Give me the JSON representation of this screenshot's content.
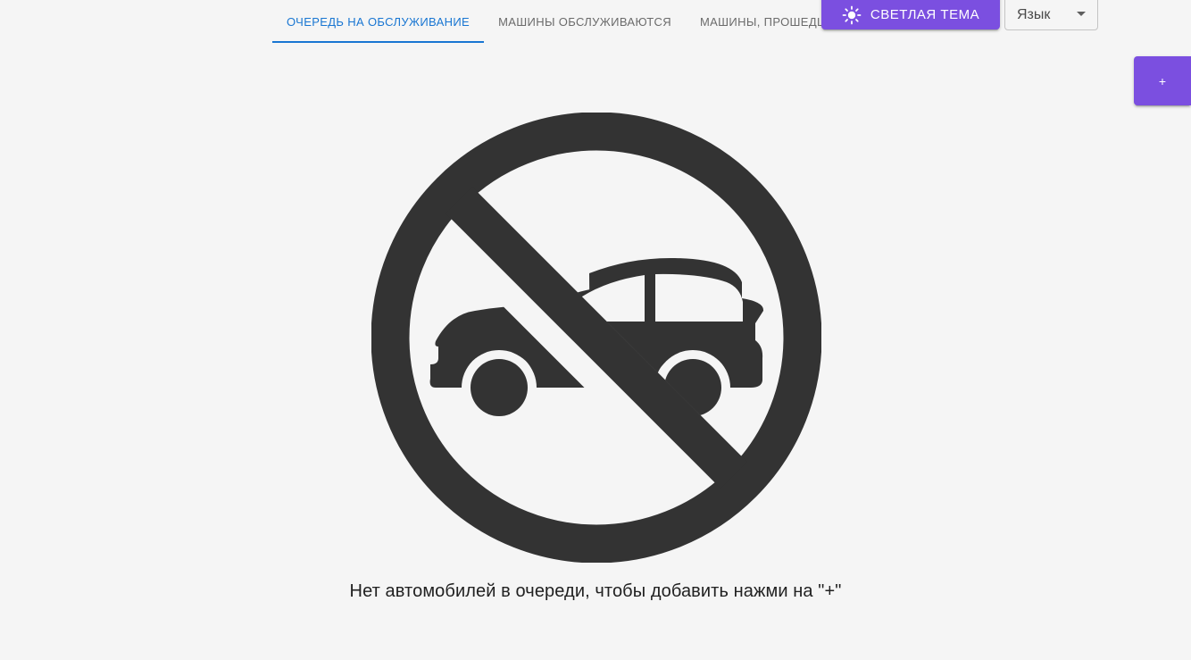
{
  "tabs": [
    {
      "label": "Очередь на обслуживание",
      "active": true
    },
    {
      "label": "Машины обслуживаются",
      "active": false
    },
    {
      "label": "Машины, прошедшие обслуживание",
      "active": false
    }
  ],
  "theme_button": {
    "label": "Светлая тема",
    "icon": "sun-icon"
  },
  "language_select": {
    "value": "Язык",
    "icon": "caret-down-icon"
  },
  "add_button": {
    "label": "+"
  },
  "empty_state": {
    "icon": "no-car-icon",
    "message": "Нет автомобилей в очереди, чтобы добавить нажми на \"+\""
  },
  "colors": {
    "accent": "#7b4fe0",
    "tab_active": "#1976d2",
    "background": "#f5f5f5",
    "icon": "#333333"
  }
}
